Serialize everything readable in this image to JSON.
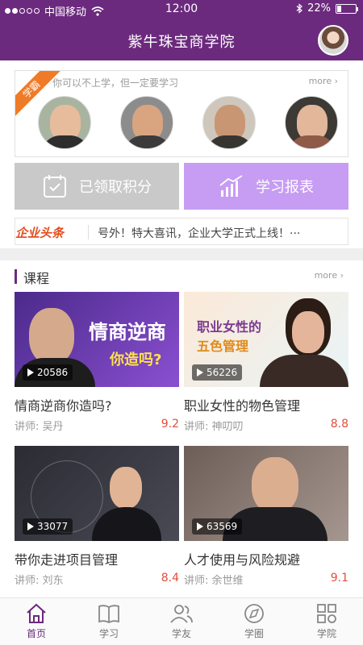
{
  "status": {
    "carrier": "中国移动",
    "time": "12:00",
    "battery": "22%",
    "battery_level": 0.22
  },
  "header": {
    "title": "紫牛珠宝商学院"
  },
  "teachers": {
    "ribbon": "学霸",
    "slogan": "你可以不上学，但一定要学习",
    "more": "more"
  },
  "actions": {
    "points_label": "已领取积分",
    "report_label": "学习报表"
  },
  "news": {
    "logo": "企业头条",
    "text": "号外！特大喜讯，企业大学正式上线！···"
  },
  "courses_section": {
    "title": "课程",
    "more": "more"
  },
  "courses": [
    {
      "title": "情商逆商你造吗?",
      "teacher": "讲师:  吴丹",
      "rating": "9.2",
      "plays": "20586",
      "art1": "情商逆商",
      "art2": "你造吗?"
    },
    {
      "title": "职业女性的物色管理",
      "teacher": "讲师:  神叨叨",
      "rating": "8.8",
      "plays": "56226",
      "art1": "职业女性的",
      "art2": "五色管理"
    },
    {
      "title": "带你走进项目管理",
      "teacher": "讲师:  刘东",
      "rating": "8.4",
      "plays": "33077"
    },
    {
      "title": "人才使用与风险规避",
      "teacher": "讲师:  余世维",
      "rating": "9.1",
      "plays": "63569"
    }
  ],
  "tabs": [
    {
      "label": "首页",
      "icon": "home-icon",
      "active": true
    },
    {
      "label": "学习",
      "icon": "book-icon"
    },
    {
      "label": "学友",
      "icon": "friends-icon"
    },
    {
      "label": "学圈",
      "icon": "compass-icon"
    },
    {
      "label": "学院",
      "icon": "grid-icon"
    }
  ],
  "colors": {
    "brand": "#6b2a7d",
    "accent_orange": "#f07b27",
    "report_purple": "#c79cf3",
    "rating_red": "#e34c3a"
  }
}
